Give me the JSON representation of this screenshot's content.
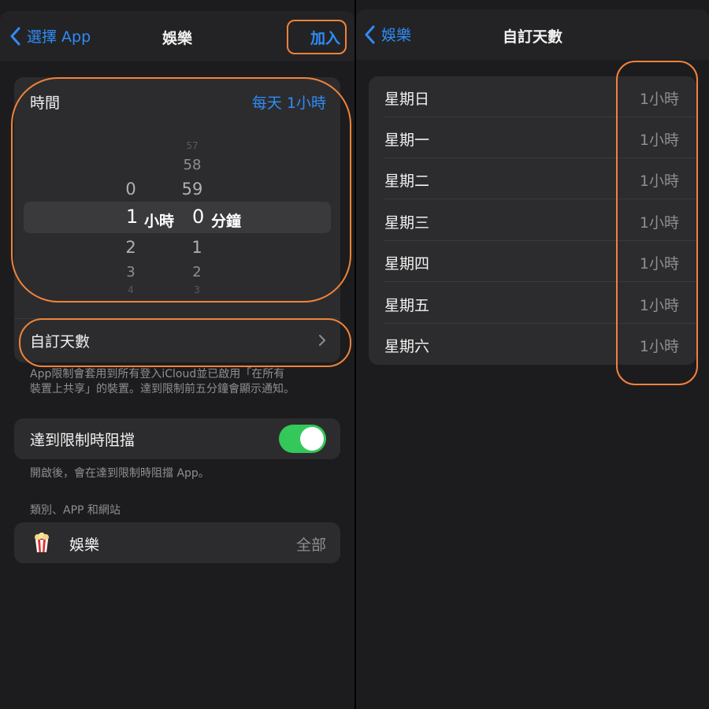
{
  "left": {
    "nav": {
      "back_label": "選擇 App",
      "title": "娛樂",
      "action_label": "加入"
    },
    "time": {
      "label": "時間",
      "value": "每天 1小時",
      "picker": {
        "hours_above": [
          "0"
        ],
        "hours_below": [
          "2",
          "3",
          "4"
        ],
        "hour_selected": "1",
        "hour_unit": "小時",
        "minutes_above": [
          "57",
          "58",
          "59"
        ],
        "minutes_below": [
          "1",
          "2",
          "3"
        ],
        "minute_selected": "0",
        "minute_unit": "分鐘"
      }
    },
    "custom_days": {
      "label": "自訂天數"
    },
    "footnote1_line1": "App限制會套用到所有登入iCloud並已啟用「在所有",
    "footnote1_line2": "裝置上共享」的裝置。達到限制前五分鐘會顯示通知。",
    "block": {
      "label": "達到限制時阻擋",
      "enabled": true
    },
    "footnote2": "開啟後，會在達到限制時阻擋 App。",
    "category_header": "類別、APP 和網站",
    "category": {
      "name": "娛樂",
      "value": "全部",
      "icon": "popcorn-icon"
    }
  },
  "right": {
    "nav": {
      "back_label": "娛樂",
      "title": "自訂天數"
    },
    "days": [
      {
        "day": "星期日",
        "value": "1小時"
      },
      {
        "day": "星期一",
        "value": "1小時"
      },
      {
        "day": "星期二",
        "value": "1小時"
      },
      {
        "day": "星期三",
        "value": "1小時"
      },
      {
        "day": "星期四",
        "value": "1小時"
      },
      {
        "day": "星期五",
        "value": "1小時"
      },
      {
        "day": "星期六",
        "value": "1小時"
      }
    ]
  },
  "colors": {
    "accent": "#2f8cf6",
    "toggle_on": "#34c759",
    "highlight": "#f0833a"
  }
}
